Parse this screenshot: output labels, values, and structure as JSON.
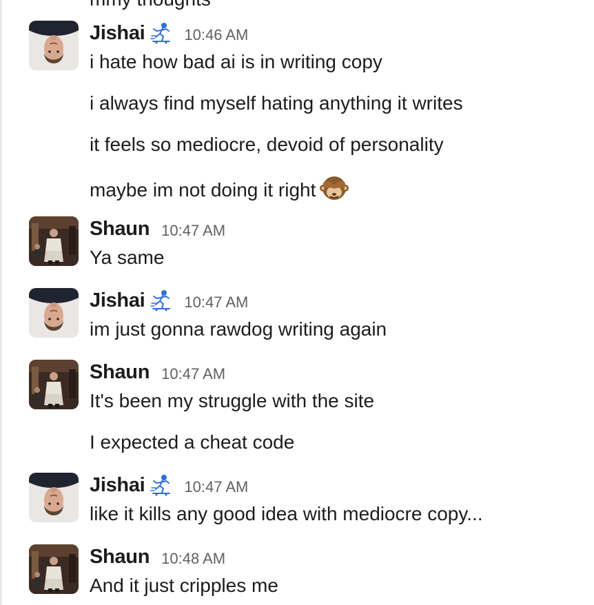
{
  "conversation": {
    "cutoff_text": "mmy thoughts",
    "groups": [
      {
        "author": "Jishai",
        "status_emoji": "skateboarder-emoji",
        "time": "10:46 AM",
        "lines": [
          "i hate how bad ai is in writing copy",
          "i always find myself hating anything it writes",
          "it feels so mediocre, devoid of personality",
          "maybe im not doing it right"
        ],
        "inline_emoji": "see-no-evil-monkey-emoji"
      },
      {
        "author": "Shaun",
        "time": "10:47 AM",
        "lines": [
          "Ya same"
        ]
      },
      {
        "author": "Jishai",
        "status_emoji": "skateboarder-emoji",
        "time": "10:47 AM",
        "lines": [
          "im just gonna rawdog writing again"
        ]
      },
      {
        "author": "Shaun",
        "time": "10:47 AM",
        "lines": [
          "It's been my struggle with the site",
          "I expected a cheat code"
        ]
      },
      {
        "author": "Jishai",
        "status_emoji": "skateboarder-emoji",
        "time": "10:47 AM",
        "lines": [
          "like it kills any good idea with mediocre copy..."
        ]
      },
      {
        "author": "Shaun",
        "time": "10:48 AM",
        "lines": [
          "And it just cripples me"
        ]
      }
    ]
  },
  "colors": {
    "text": "#1d1c1d",
    "timestamp": "#616061",
    "status_emoji": "#2f6fd6"
  }
}
